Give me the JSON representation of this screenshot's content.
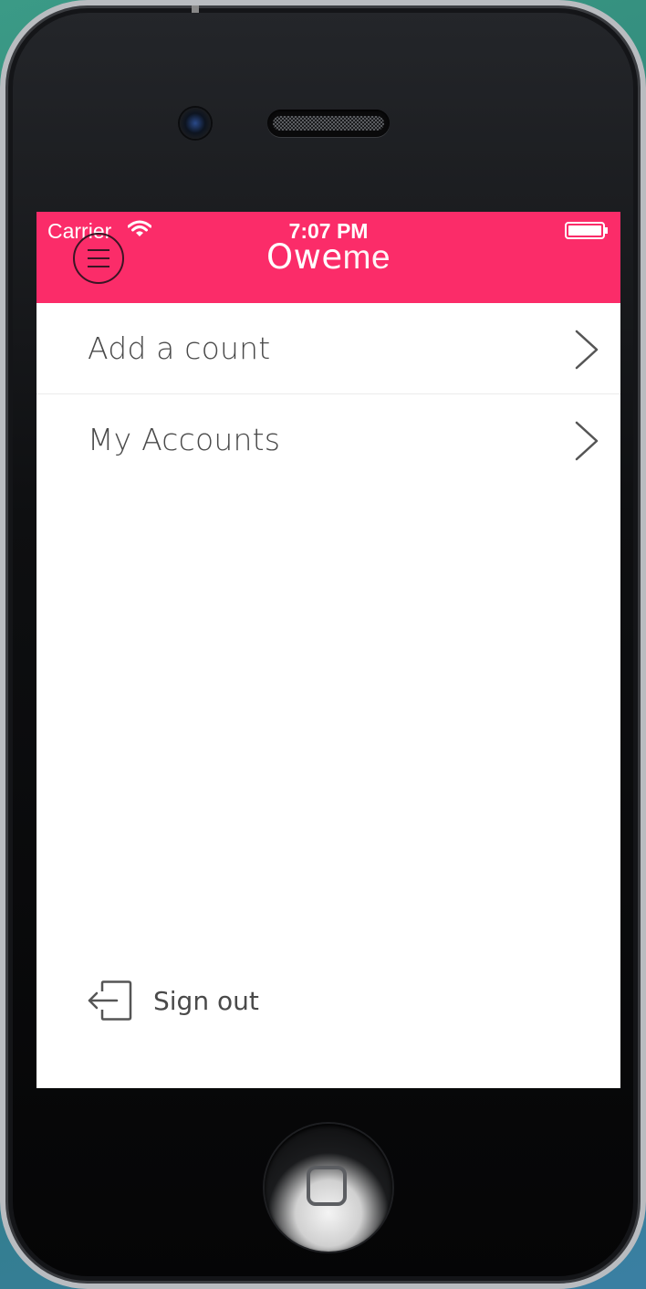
{
  "status_bar": {
    "carrier": "Carrier",
    "time": "7:07 PM",
    "wifi_icon": "wifi-icon",
    "battery_icon": "battery-icon"
  },
  "nav": {
    "title_bold": "Owe",
    "title_light": "me",
    "menu_icon": "hamburger-menu-icon",
    "accent_color": "#fb2c69"
  },
  "menu": {
    "items": [
      {
        "label": "Add a count",
        "icon": "chevron-right-icon"
      },
      {
        "label": "My Accounts",
        "icon": "chevron-right-icon"
      }
    ]
  },
  "footer": {
    "signout_label": "Sign out",
    "signout_icon": "sign-out-icon"
  }
}
